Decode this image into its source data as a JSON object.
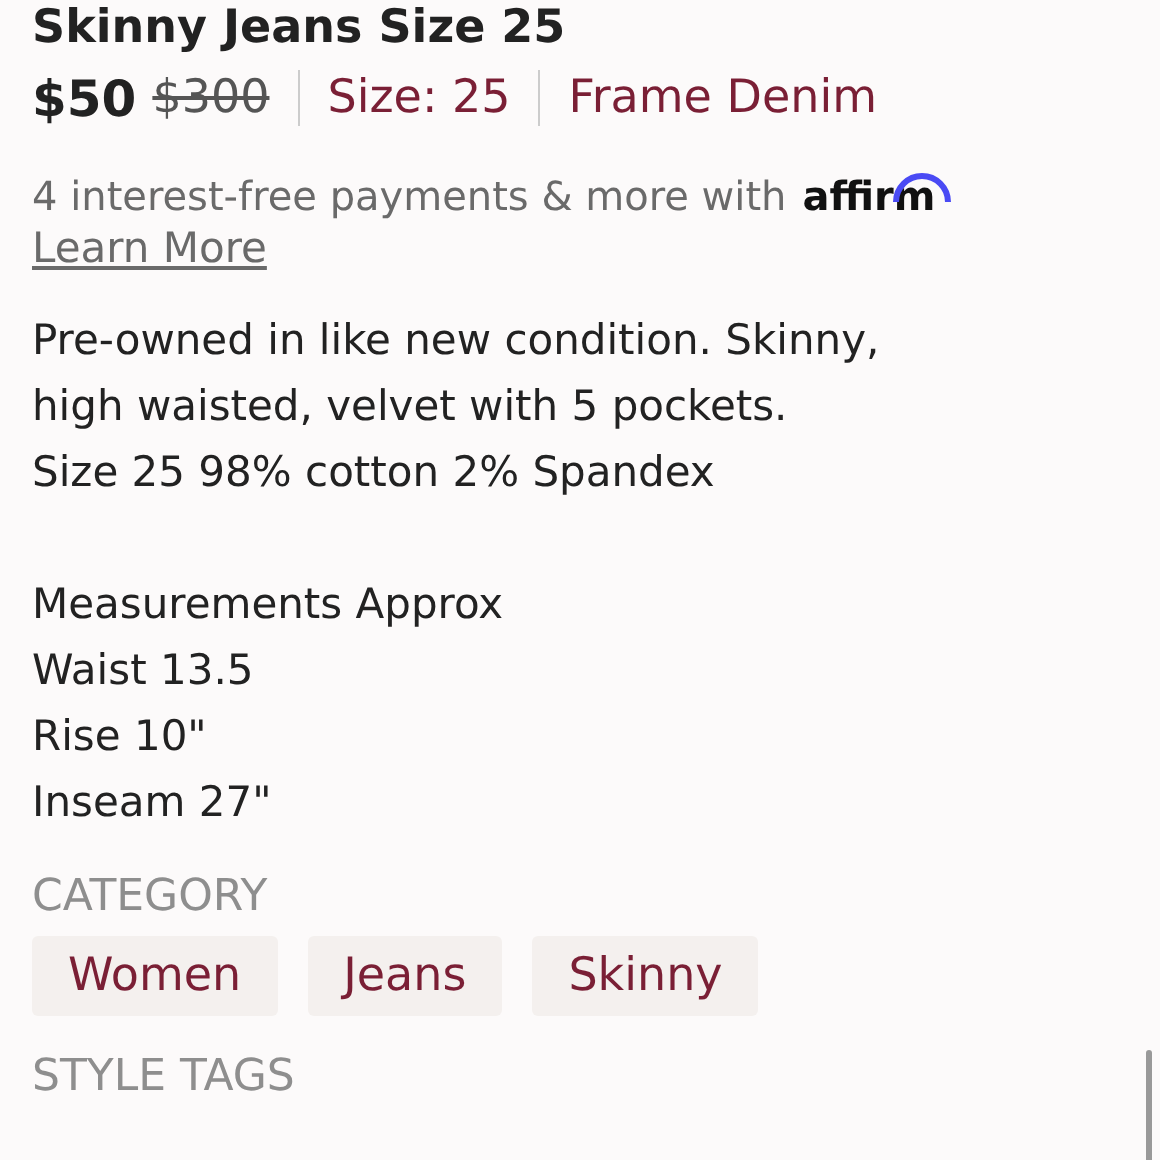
{
  "title": "Skinny Jeans Size 25",
  "price": {
    "current": "$50",
    "original": "$300",
    "size": "Size: 25",
    "brand": "Frame Denim"
  },
  "financing": {
    "text": "4 interest-free payments & more with",
    "logo": "affirm",
    "link": "Learn More"
  },
  "description": [
    [
      "Pre-owned in like new condition. Skinny,",
      "high waisted, velvet with 5 pockets.",
      "Size 25 98% cotton 2% Spandex"
    ],
    [
      "Measurements Approx",
      "Waist 13.5",
      "Rise 10\"",
      "Inseam 27\""
    ]
  ],
  "category": {
    "heading": "CATEGORY",
    "tags": [
      "Women",
      "Jeans",
      "Skinny"
    ]
  },
  "style_tags": {
    "heading": "STYLE TAGS"
  }
}
